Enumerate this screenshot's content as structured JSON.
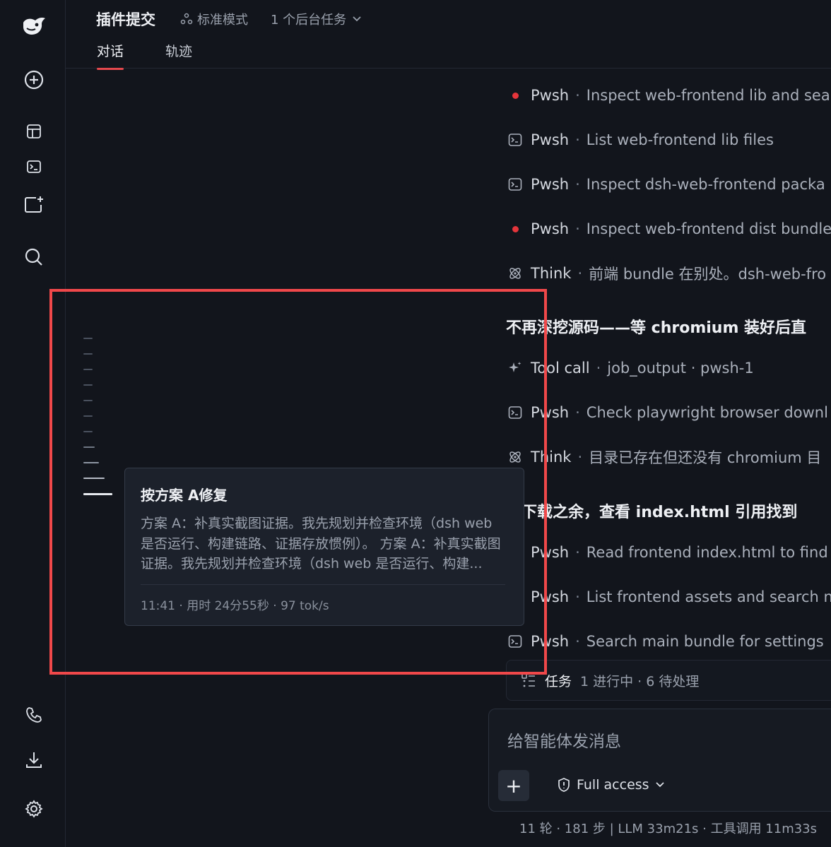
{
  "header": {
    "title": "插件提交",
    "mode": "标准模式",
    "background_tasks": "1 个后台任务",
    "tabs": [
      "对话",
      "轨迹"
    ]
  },
  "activity": [
    {
      "icon": "red-dot-icon",
      "kind": "Pwsh",
      "sep": "·",
      "desc": "Inspect web-frontend lib and sea"
    },
    {
      "icon": "terminal-icon",
      "kind": "Pwsh",
      "sep": "·",
      "desc": "List web-frontend lib files"
    },
    {
      "icon": "terminal-icon",
      "kind": "Pwsh",
      "sep": "·",
      "desc": "Inspect dsh-web-frontend packa"
    },
    {
      "icon": "red-dot-icon",
      "kind": "Pwsh",
      "sep": "·",
      "desc": "Inspect web-frontend dist bundle"
    },
    {
      "icon": "atom-icon",
      "kind": "Think",
      "sep": "·",
      "desc": "前端 bundle 在别处。dsh-web-fro"
    },
    {
      "icon": "sparkle-icon",
      "kind": "Tool call",
      "sep": "·",
      "desc": "job_output · pwsh-1"
    },
    {
      "icon": "terminal-icon",
      "kind": "Pwsh",
      "sep": "·",
      "desc": "Check playwright browser downl"
    },
    {
      "icon": "atom-icon",
      "kind": "Think",
      "sep": "·",
      "desc": "目录已存在但还没有 chromium 目"
    },
    {
      "icon": "terminal-icon",
      "kind": "Pwsh",
      "sep": "·",
      "desc": "Read frontend index.html to find"
    },
    {
      "icon": "terminal-icon",
      "kind": "Pwsh",
      "sep": "·",
      "desc": "List frontend assets and search n"
    },
    {
      "icon": "terminal-icon",
      "kind": "Pwsh",
      "sep": "·",
      "desc": "Search main bundle for settings"
    }
  ],
  "headings": [
    "不再深挖源码——等 chromium 装好后直",
    "待下载之余，查看 index.html 引用找到"
  ],
  "tasks": {
    "label": "任务",
    "status": "1 进行中 · 6 待处理"
  },
  "composer": {
    "placeholder": "给智能体发消息",
    "access": "Full access"
  },
  "footer": "11 轮 · 181 步  |  LLM 33m21s · 工具调用 11m33s",
  "tooltip": {
    "title": "按方案 A修复",
    "body": "方案 A：补真实截图证据。我先规划并检查环境（dsh web 是否运行、构建链路、证据存放惯例）。 方案 A：补真实截图证据。我先规划并检查环境（dsh web 是否运行、构建...",
    "meta": "11:41 · 用时 24分55秒 · 97 tok/s"
  },
  "colors": {
    "accent_red": "#e5484d",
    "highlight_box": "#f0484a",
    "background": "#12151c"
  }
}
